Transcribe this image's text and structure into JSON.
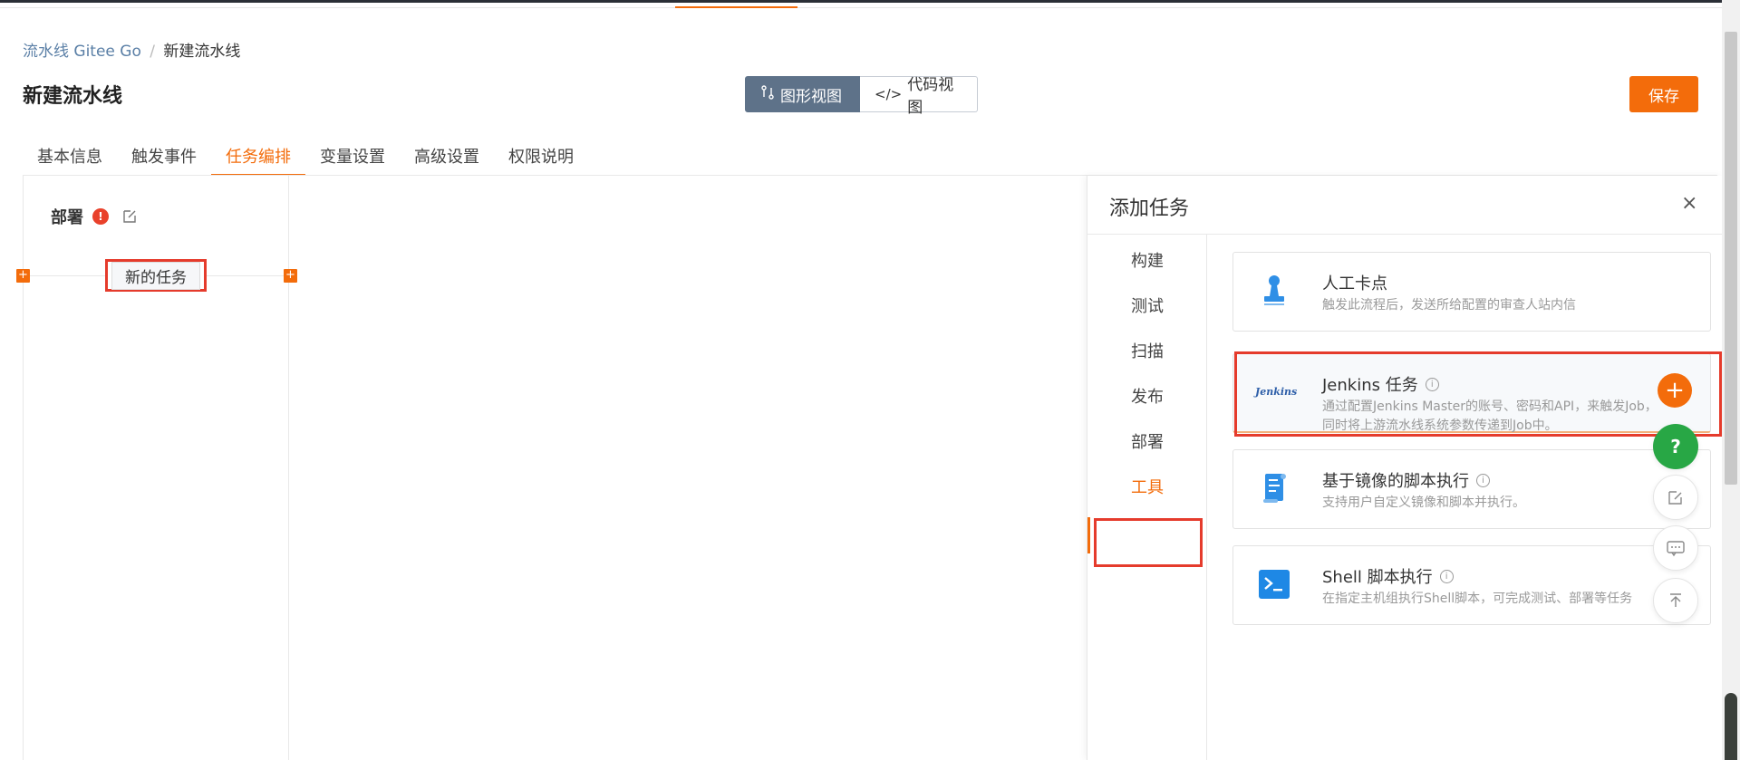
{
  "breadcrumb": {
    "root": "流水线 Gitee Go",
    "sep": "/",
    "current": "新建流水线"
  },
  "page": {
    "title": "新建流水线"
  },
  "view_toggle": {
    "graphic": "图形视图",
    "code": "代码视图"
  },
  "toolbar": {
    "save_label": "保存"
  },
  "tabs": [
    {
      "label": "基本信息"
    },
    {
      "label": "触发事件"
    },
    {
      "label": "任务编排",
      "active": true
    },
    {
      "label": "变量设置"
    },
    {
      "label": "高级设置"
    },
    {
      "label": "权限说明"
    }
  ],
  "stage": {
    "title": "部署",
    "warn": "!",
    "node_label": "新的任务"
  },
  "panel": {
    "title": "添加任务",
    "close": "×",
    "categories": [
      {
        "label": "构建"
      },
      {
        "label": "测试"
      },
      {
        "label": "扫描"
      },
      {
        "label": "发布"
      },
      {
        "label": "部署"
      },
      {
        "label": "工具",
        "selected": true
      }
    ],
    "cards": [
      {
        "title": "人工卡点",
        "desc": "触发此流程后，发送所给配置的审查人站内信",
        "icon": "stamp-icon"
      },
      {
        "title": "Jenkins 任务",
        "desc": "通过配置Jenkins Master的账号、密码和API，来触发Job，同时将上游流水线系统参数传递到Job中。",
        "icon": "jenkins-logo",
        "logo_text": "Jenkins"
      },
      {
        "title": "基于镜像的脚本执行",
        "desc": "支持用户自定义镜像和脚本并执行。",
        "icon": "script-scroll-icon"
      },
      {
        "title": "Shell 脚本执行",
        "desc": "在指定主机组执行Shell脚本，可完成测试、部署等任务",
        "icon": "terminal-icon"
      }
    ]
  },
  "colors": {
    "accent": "#f36c0b",
    "toggle_active": "#5e7289",
    "help_green": "#28a745",
    "highlight_red": "#e53b2c"
  }
}
